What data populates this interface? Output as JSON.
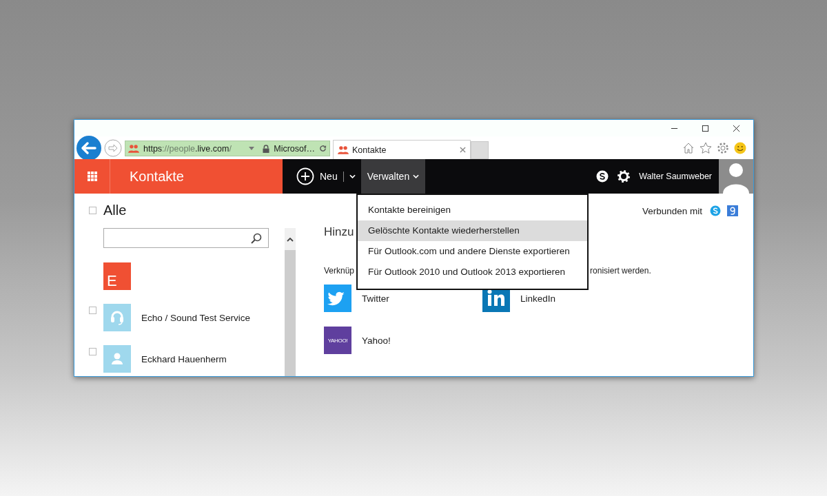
{
  "browser": {
    "address_bar": {
      "url_parts": [
        {
          "text": "https",
          "dim": false
        },
        {
          "text": "://",
          "dim": true
        },
        {
          "text": "people",
          "dim": true
        },
        {
          "text": ".live.com",
          "dim": false
        },
        {
          "text": "/",
          "dim": true
        }
      ],
      "site_identity": "Microsof…"
    },
    "tabs": [
      {
        "label": "Kontakte",
        "selected": true
      }
    ]
  },
  "app_bar": {
    "app_title": "Kontakte",
    "commands": [
      {
        "label": "Neu",
        "kind": "new",
        "selected": false
      },
      {
        "label": "Verwalten",
        "kind": "menu",
        "selected": true
      }
    ],
    "user_name": "Walter Saumweber"
  },
  "manage_menu": {
    "items": [
      {
        "label": "Kontakte bereinigen",
        "selected": false
      },
      {
        "label": "Gelöschte Kontakte wiederherstellen",
        "selected": true
      },
      {
        "label": "Für Outlook.com und andere Dienste exportieren",
        "selected": false
      },
      {
        "label": "Für Outlook 2010 und Outlook 2013 exportieren",
        "selected": false
      }
    ]
  },
  "sidebar": {
    "filter": {
      "label": "Alle",
      "checked": false
    },
    "letter_header": "E",
    "contacts": [
      {
        "name": "Echo / Sound Test Service",
        "kind": "service",
        "checked": false
      },
      {
        "name": "Eckhard Hauenherm",
        "kind": "person",
        "checked": false
      }
    ]
  },
  "main": {
    "connected_label": "Verbunden mit",
    "heading": "Hinzu",
    "description_start": "Verknüp",
    "description_end": "ronisiert werden.",
    "services": [
      {
        "name": "Twitter",
        "kind": "twitter"
      },
      {
        "name": "LinkedIn",
        "kind": "linkedin"
      },
      {
        "name": "Yahoo!",
        "kind": "yahoo",
        "logo_text": "YAHOO!"
      }
    ]
  }
}
